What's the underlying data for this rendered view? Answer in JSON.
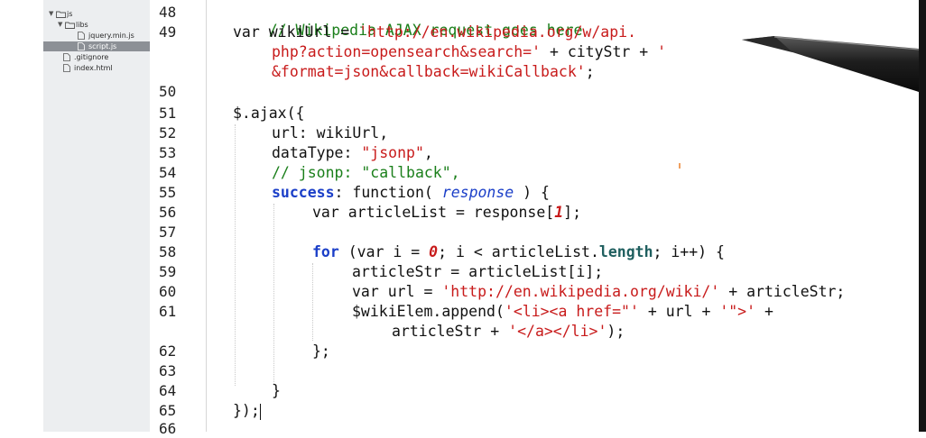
{
  "sidebar": {
    "items": [
      {
        "label": "js",
        "kind": "folder"
      },
      {
        "label": "libs",
        "kind": "folder"
      },
      {
        "label": "jquery.min.js",
        "kind": "file"
      },
      {
        "label": "script.js",
        "kind": "file",
        "selected": true
      },
      {
        "label": ".gitignore",
        "kind": "file"
      },
      {
        "label": "index.html",
        "kind": "file"
      }
    ]
  },
  "gutter": {
    "line_numbers": [
      "48",
      "49",
      "50",
      "51",
      "52",
      "53",
      "54",
      "55",
      "56",
      "57",
      "58",
      "59",
      "60",
      "61",
      "62",
      "63",
      "64",
      "65",
      "66"
    ],
    "active_line": "65"
  },
  "code": {
    "l48": "// Wikipedia AJAX request goes here",
    "l49a": "var wikiUrl = ",
    "l49b": "'http://en.wikipedia.org/w/api.",
    "l49c": "php?action=opensearch&search='",
    "l49d": " + cityStr + ",
    "l49e": "'",
    "l49f": "&format=json&callback=wikiCallback'",
    "l49g": ";",
    "l51": "$.ajax({",
    "l52": "url: wikiUrl,",
    "l53a": "dataType: ",
    "l53b": "\"jsonp\"",
    "l53c": ",",
    "l54": "// jsonp: \"callback\",",
    "l55a": "success",
    "l55b": ": function( ",
    "l55c": "response",
    "l55d": " ) {",
    "l56a": "var articleList = response[",
    "l56b": "1",
    "l56c": "];",
    "l58a": "for",
    "l58b": " (var i = ",
    "l58c": "0",
    "l58d": "; i < articleList.",
    "l58e": "length",
    "l58f": "; i++) {",
    "l59": "articleStr = articleList[i];",
    "l60a": "var url = ",
    "l60b": "'http://en.wikipedia.org/wiki/'",
    "l60c": " + articleStr;",
    "l61a": "$wikiElem.append(",
    "l61b": "'<li><a href=\"'",
    "l61c": " + url + ",
    "l61d": "'\">'",
    "l61e": " +",
    "l61f": "articleStr + ",
    "l61g": "'</a></li>'",
    "l61h": ");",
    "l62": "};",
    "l64": "}",
    "l65": "});"
  }
}
